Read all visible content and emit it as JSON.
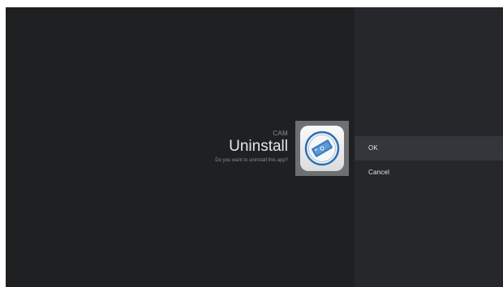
{
  "dialog": {
    "app_name": "CAM",
    "title": "Uninstall",
    "question": "Do you want to uninstall this app?",
    "app_icon": "camera-app-icon"
  },
  "options": [
    {
      "label": "OK",
      "focused": true
    },
    {
      "label": "Cancel",
      "focused": false
    }
  ],
  "colors": {
    "background": "#1e2022",
    "options_panel": "#25272a",
    "focused_option": "#33363a",
    "icon_accent": "#2f6fb0"
  }
}
